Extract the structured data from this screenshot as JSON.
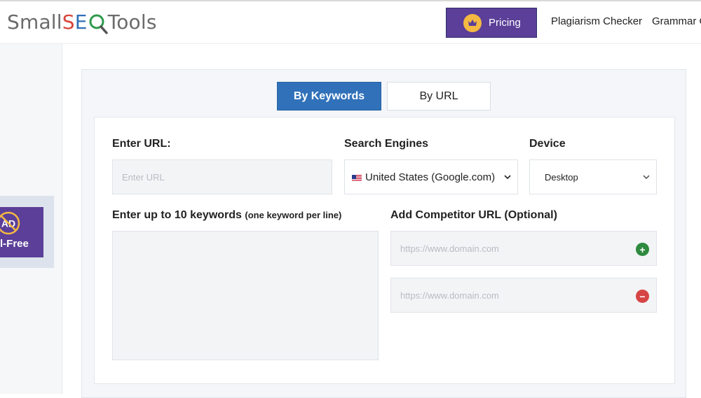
{
  "logo": {
    "part1": "Small",
    "part_s": "S",
    "part_e": "E",
    "part2": "Tools"
  },
  "header": {
    "pricing_label": "Pricing",
    "nav": [
      "Plagiarism Checker",
      "Grammar C"
    ]
  },
  "ad_banner": {
    "badge": "AD",
    "text": "l-Free"
  },
  "tabs": {
    "active": "By Keywords",
    "inactive": "By URL"
  },
  "form": {
    "url_label": "Enter URL:",
    "url_placeholder": "Enter URL",
    "engines_label": "Search Engines",
    "engine_value": "United States (Google.com)",
    "device_label": "Device",
    "device_value": "Desktop",
    "keywords_label": "Enter up to 10 keywords",
    "keywords_hint": "(one keyword per line)",
    "competitor_label": "Add Competitor URL (Optional)",
    "competitor_placeholder_1": "https://www.domain.com",
    "competitor_placeholder_2": "https://www.domain.com"
  },
  "colors": {
    "brand_purple": "#5b3f98",
    "tab_blue": "#3071b9",
    "add_green": "#2e8a3e",
    "remove_red": "#d64545"
  }
}
